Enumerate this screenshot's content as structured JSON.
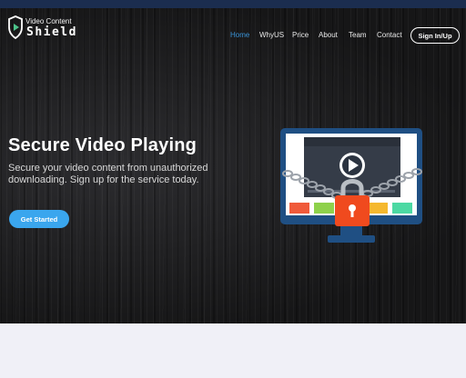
{
  "brand": {
    "line1": "Video Content",
    "line2": "Shield"
  },
  "nav": {
    "items": [
      {
        "label": "Home",
        "active": true
      },
      {
        "label": "WhyUS",
        "active": false
      },
      {
        "label": "Price",
        "active": false
      },
      {
        "label": "About",
        "active": false
      },
      {
        "label": "Team",
        "active": false
      },
      {
        "label": "Contact",
        "active": false
      }
    ],
    "signin_label": "Sign In/Up"
  },
  "hero": {
    "title": "Secure Video Playing",
    "subtitle": "Secure your video content from unauthorized downloading. Sign up for the service today.",
    "cta_label": "Get Started",
    "illustration_icon": "video-lock-monitor-icon"
  },
  "colors": {
    "accent": "#3aa6ee",
    "nav_active": "#3a93d6",
    "top_strip": "#1b2d4f",
    "hero_bg": "#1b1b1d",
    "lock": "#f04a1e"
  }
}
